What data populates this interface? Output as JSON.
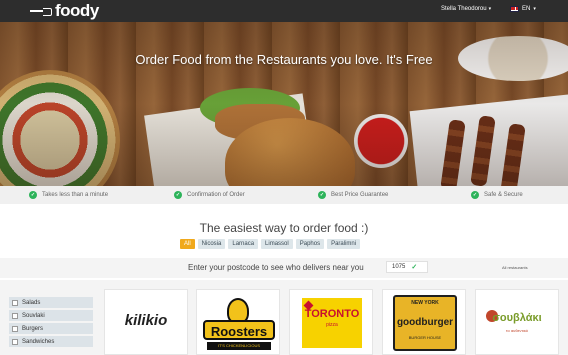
{
  "header": {
    "logo": "foody",
    "user_name": "Stella Theodorou",
    "language": "EN",
    "caret": "▾"
  },
  "hero": {
    "title": "Order Food from the Restaurants you love. It's Free"
  },
  "features": [
    {
      "label": "Takes less than a minute"
    },
    {
      "label": "Confirmation of Order"
    },
    {
      "label": "Best Price Guarantee"
    },
    {
      "label": "Safe & Secure"
    }
  ],
  "tagline": "The easiest way to order food :)",
  "cities": [
    "All",
    "Nicosia",
    "Larnaca",
    "Limassol",
    "Paphos",
    "Paralimni"
  ],
  "postcode": {
    "label": "Enter your postcode to see who delivers near you",
    "value": "1075",
    "all_restaurants": "All restaurants"
  },
  "categories": [
    "Salads",
    "Souvlaki",
    "Burgers",
    "Sandwiches"
  ],
  "restaurants": {
    "kilikio": "kilikio",
    "roosters": "Roosters",
    "roosters_sub": "IT'S CHICKENLICIOUS",
    "toronto": "TORONTO",
    "toronto_sub": "pizza",
    "goodburger_top": "NEW YORK",
    "goodburger": "goodburger",
    "goodburger_sub": "BURGER HOUSE",
    "souvlaki": "σουβλάκι",
    "souvlaki_sub": "το αυθεντικό"
  },
  "colors": {
    "topbar": "#2d2d2d",
    "accent": "#f0a91c",
    "check": "#2db35a"
  }
}
